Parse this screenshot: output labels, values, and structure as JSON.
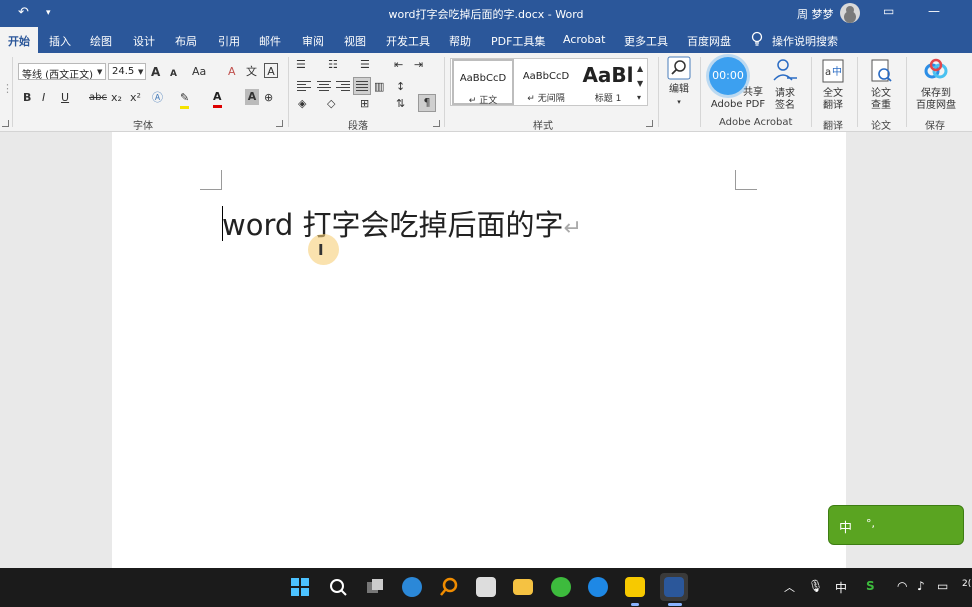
{
  "window": {
    "title": "word打字会吃掉后面的字.docx  -  Word",
    "user": "周 梦梦",
    "undo_icon": "undo-icon",
    "minimize_icon": "ribbon-display-icon"
  },
  "tabs": [
    "开始",
    "插入",
    "绘图",
    "设计",
    "布局",
    "引用",
    "邮件",
    "审阅",
    "视图",
    "开发工具",
    "帮助",
    "PDF工具集",
    "Acrobat",
    "更多工具",
    "百度网盘"
  ],
  "active_tab": "开始",
  "tell_me": "操作说明搜索",
  "ribbon": {
    "font": {
      "label": "字体",
      "name": "等线 (西文正文)",
      "size": "24.5",
      "grow": "A",
      "shrink": "A",
      "case": "Aa",
      "clear": "A",
      "bold": "B",
      "italic": "I",
      "underline": "U",
      "strike": "abc",
      "subscript": "x₂",
      "superscript": "x²",
      "font_color": "A",
      "char_shading": "A"
    },
    "paragraph": {
      "label": "段落"
    },
    "styles": {
      "label": "样式",
      "items": [
        {
          "preview": "AaBbCcD",
          "name": "↵ 正文"
        },
        {
          "preview": "AaBbCcD",
          "name": "↵ 无间隔"
        },
        {
          "preview": "AaBl",
          "name": "标题 1"
        }
      ]
    },
    "editing": {
      "label": "编辑"
    },
    "acrobat": {
      "label": "Adobe Acrobat",
      "share_top": "共享",
      "share_bottom": "Adobe PDF",
      "sign_top": "请求",
      "sign_bottom": "签名"
    },
    "translate": {
      "label": "翻译",
      "top": "全文",
      "bottom": "翻译"
    },
    "paper": {
      "label": "论文",
      "top": "论文",
      "bottom": "查重"
    },
    "save": {
      "label": "保存",
      "top": "保存到",
      "bottom": "百度网盘"
    }
  },
  "recording_timer": "00:00",
  "document": {
    "text": "word 打字会吃掉后面的字",
    "paragraph_mark": "↵"
  },
  "ime": {
    "mode": "中",
    "punct": "°,"
  },
  "taskbar": {
    "tray_lang": "中",
    "tray_time": "2("
  },
  "colors": {
    "word_blue": "#2b579a",
    "ribbon_bg": "#f3f3f3",
    "ime_green": "#5aa421",
    "taskbar_bg": "#1b1b1b"
  }
}
